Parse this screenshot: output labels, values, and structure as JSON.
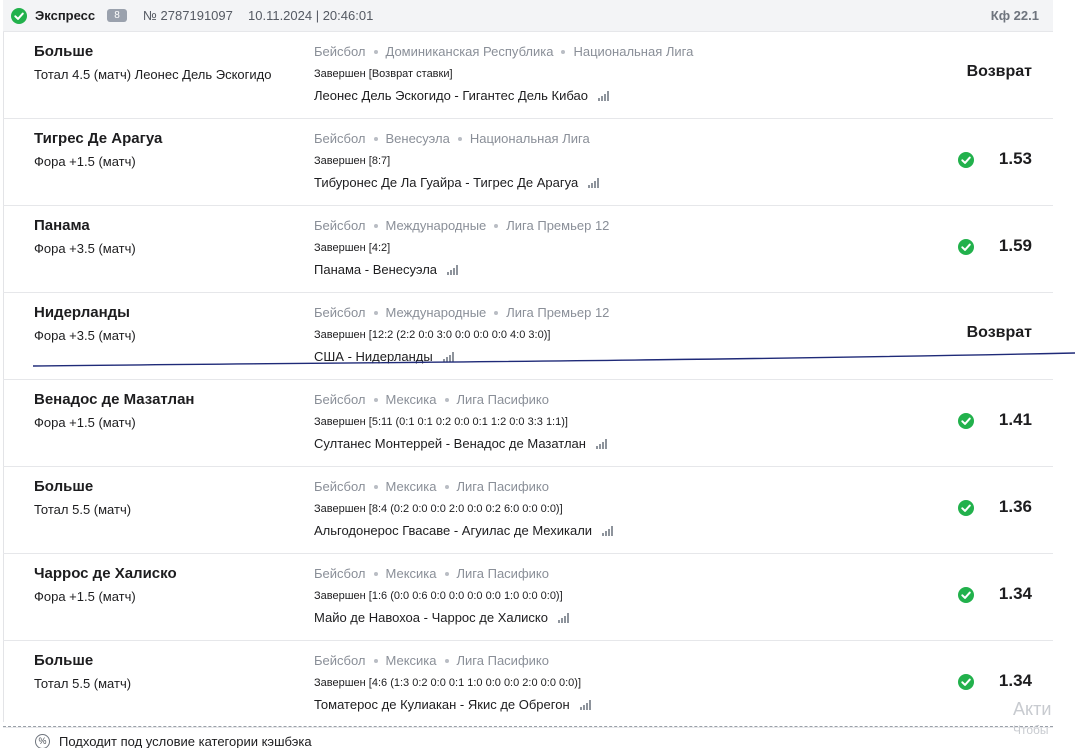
{
  "header": {
    "type": "Экспресс",
    "count": "8",
    "number": "№ 2787191097",
    "datetime": "10.11.2024 | 20:46:01",
    "coef": "Кф 22.1",
    "check_icon": "check-circle-icon",
    "accent_color": "#22b14c"
  },
  "events": [
    {
      "name": "Больше",
      "market": "Тотал 4.5 (матч) Леонес Дель Эскогидо",
      "sport": "Бейсбол",
      "country": "Доминиканская Республика",
      "league": "Национальная Лига",
      "status": "Завершен [Возврат ставки]",
      "match": "Леонес Дель Эскогидо - Гигантес Дель Кибао",
      "result": "Возврат",
      "odds": ""
    },
    {
      "name": "Тигрес Де Арагуа",
      "market": "Фора +1.5 (матч)",
      "sport": "Бейсбол",
      "country": "Венесуэла",
      "league": "Национальная Лига",
      "status": "Завершен [8:7]",
      "match": "Тибуронес Де Ла Гуайра - Тигрес Де Арагуа",
      "result": "",
      "odds": "1.53"
    },
    {
      "name": "Панама",
      "market": "Фора +3.5 (матч)",
      "sport": "Бейсбол",
      "country": "Международные",
      "league": "Лига Премьер 12",
      "status": "Завершен [4:2]",
      "match": "Панама - Венесуэла",
      "result": "",
      "odds": "1.59"
    },
    {
      "name": "Нидерланды",
      "market": "Фора +3.5 (матч)",
      "sport": "Бейсбол",
      "country": "Международные",
      "league": "Лига Премьер 12",
      "status": "Завершен [12:2 (2:2 0:0 3:0 0:0 0:0 0:0 4:0 3:0)]",
      "match": "США - Нидерланды",
      "result": "Возврат",
      "odds": ""
    },
    {
      "name": "Венадос де Мазатлан",
      "market": "Фора +1.5 (матч)",
      "sport": "Бейсбол",
      "country": "Мексика",
      "league": "Лига Пасифико",
      "status": "Завершен [5:11 (0:1 0:1 0:2 0:0 0:1 1:2 0:0 3:3 1:1)]",
      "match": "Султанес Монтеррей - Венадос де Мазатлан",
      "result": "",
      "odds": "1.41"
    },
    {
      "name": "Больше",
      "market": "Тотал 5.5 (матч)",
      "sport": "Бейсбол",
      "country": "Мексика",
      "league": "Лига Пасифико",
      "status": "Завершен [8:4 (0:2 0:0 0:0 2:0 0:0 0:2 6:0 0:0 0:0)]",
      "match": "Альгодонерос Гвасаве - Агуилас де Мехикали",
      "result": "",
      "odds": "1.36"
    },
    {
      "name": "Чаррос де Халиско",
      "market": "Фора +1.5 (матч)",
      "sport": "Бейсбол",
      "country": "Мексика",
      "league": "Лига Пасифико",
      "status": "Завершен [1:6 (0:0 0:6 0:0 0:0 0:0 0:0 1:0 0:0 0:0)]",
      "match": "Майо де Навохоа - Чаррос де Халиско",
      "result": "",
      "odds": "1.34"
    },
    {
      "name": "Больше",
      "market": "Тотал 5.5 (матч)",
      "sport": "Бейсбол",
      "country": "Мексика",
      "league": "Лига Пасифико",
      "status": "Завершен [4:6 (1:3 0:2 0:0 0:1 1:0 0:0 0:0 2:0 0:0 0:0)]",
      "match": "Томатерос де Кулиакан - Якис де Обрегон",
      "result": "",
      "odds": "1.34"
    }
  ],
  "footer": {
    "cashback_icon": "percent-icon",
    "cashback": "Подходит под условие категории кэшбэка"
  },
  "watermark": {
    "line1": "Акти",
    "line2": "Чтобы"
  }
}
